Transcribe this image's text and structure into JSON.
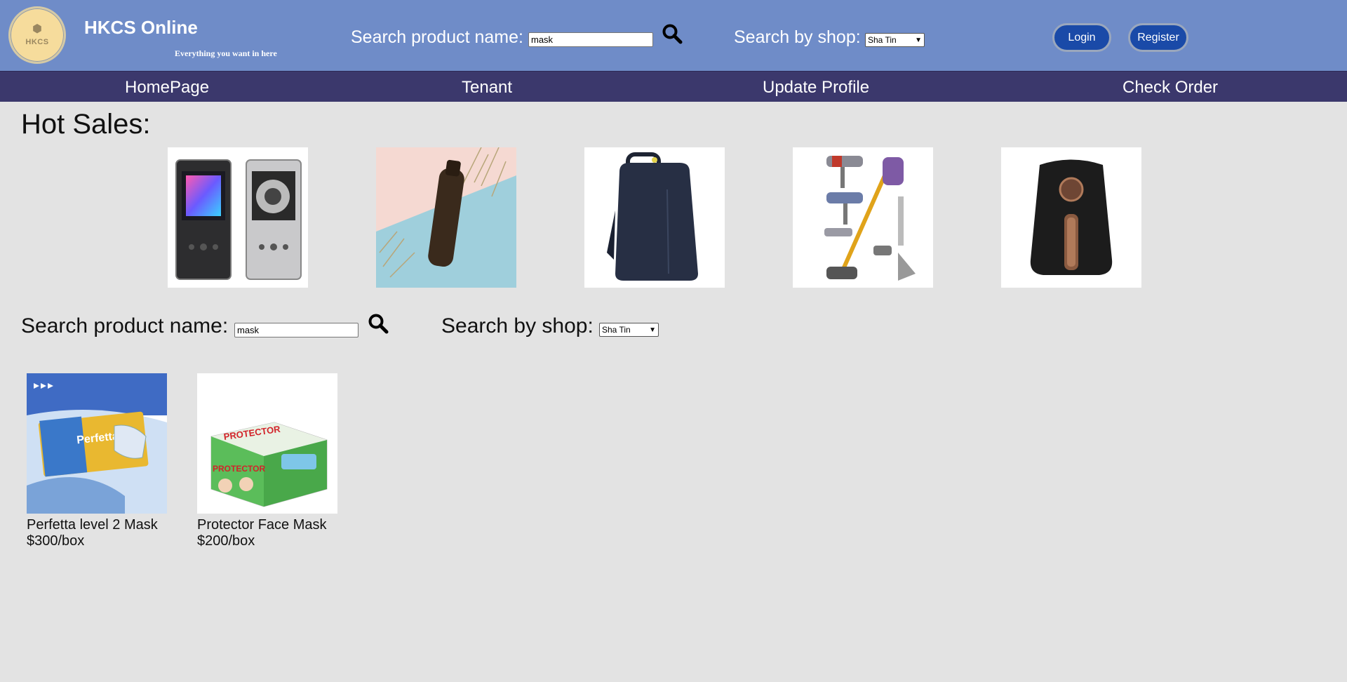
{
  "header": {
    "logo_text": "HKCS",
    "title": "HKCS Online",
    "tagline": "Everything you want in here",
    "search_label": "Search product name:",
    "search_value": "mask",
    "shop_label": "Search by shop:",
    "shop_selected": "Sha Tin",
    "login_label": "Login",
    "register_label": "Register"
  },
  "nav": {
    "items": [
      "HomePage",
      "Tenant",
      "Update Profile",
      "Check Order"
    ]
  },
  "hot_sales": {
    "title": "Hot Sales:",
    "products": [
      "walkman-player",
      "skincare-bottle",
      "backpack",
      "cordless-vacuum",
      "air-fryer"
    ]
  },
  "search": {
    "label": "Search product name:",
    "value": "mask",
    "shop_label": "Search by shop:",
    "shop_selected": "Sha Tin"
  },
  "results": [
    {
      "name": "Perfetta level 2 Mask",
      "price": "$300/box"
    },
    {
      "name": "Protector Face Mask",
      "price": "$200/box"
    }
  ],
  "colors": {
    "header_bg": "#6f8cc8",
    "nav_bg": "#3b386c",
    "page_bg": "#e3e3e3",
    "button_bg": "#1a4aa8"
  }
}
